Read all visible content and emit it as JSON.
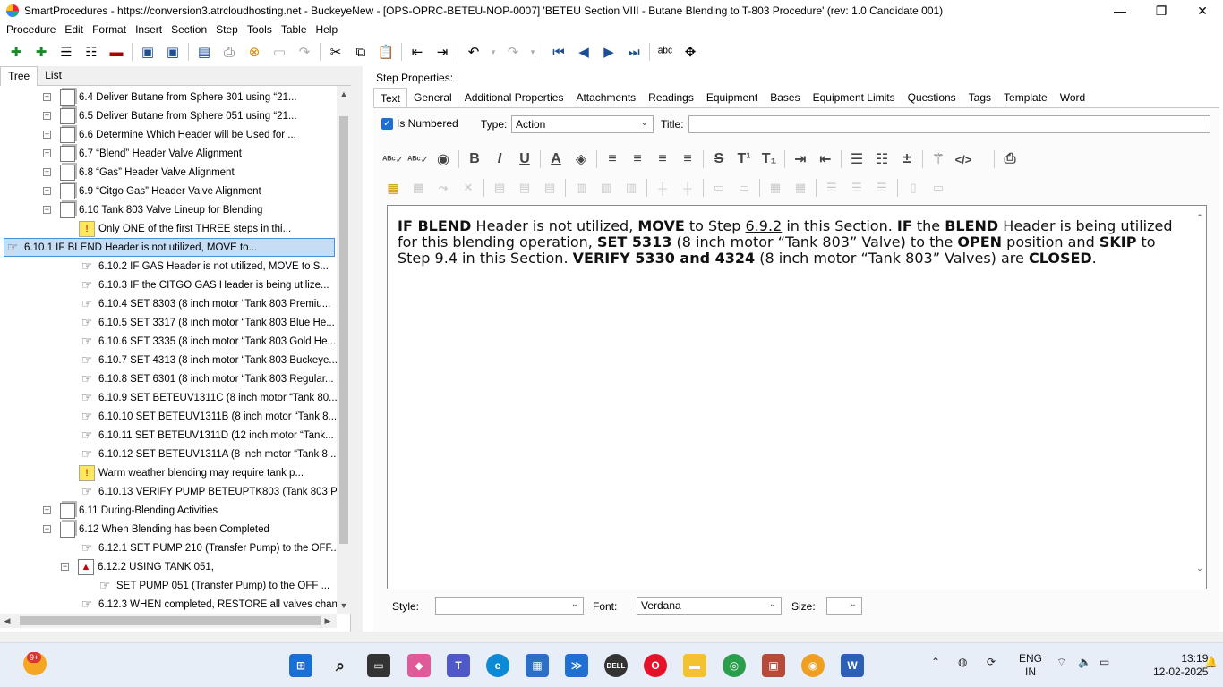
{
  "window": {
    "title": "SmartProcedures - https://conversion3.atrcloudhosting.net - BuckeyeNew - [OPS-OPRC-BETEU-NOP-0007] 'BETEU Section VIII - Butane Blending to T-803 Procedure' (rev: 1.0 Candidate 001)",
    "minimize": "—",
    "maximize": "❐",
    "close": "✕"
  },
  "menu": [
    "Procedure",
    "Edit",
    "Format",
    "Insert",
    "Section",
    "Step",
    "Tools",
    "Table",
    "Help"
  ],
  "left_tabs": [
    "Tree",
    "List"
  ],
  "tree": [
    {
      "label": "6.4 Deliver Butane from Sphere 301 using “21...",
      "indent": 0,
      "kind": "section",
      "expander": "+"
    },
    {
      "label": "6.5 Deliver Butane from Sphere 051 using “21...",
      "indent": 0,
      "kind": "section",
      "expander": "+"
    },
    {
      "label": "6.6 Determine Which Header will be Used for ...",
      "indent": 0,
      "kind": "section",
      "expander": "+"
    },
    {
      "label": "6.7 “Blend” Header Valve Alignment",
      "indent": 0,
      "kind": "section",
      "expander": "+"
    },
    {
      "label": "6.8 “Gas” Header Valve Alignment",
      "indent": 0,
      "kind": "section",
      "expander": "+"
    },
    {
      "label": "6.9 “Citgo Gas” Header Valve Alignment",
      "indent": 0,
      "kind": "section",
      "expander": "+"
    },
    {
      "label": "6.10 Tank 803 Valve Lineup for Blending",
      "indent": 0,
      "kind": "section",
      "expander": "−"
    },
    {
      "label": "Only ONE of the first THREE steps in thi...",
      "indent": 1,
      "kind": "note"
    },
    {
      "label": "6.10.1 IF BLEND Header is not utilized, MOVE to...",
      "indent": 1,
      "kind": "step",
      "selected": true
    },
    {
      "label": "6.10.2 IF GAS Header is not utilized, MOVE to S...",
      "indent": 1,
      "kind": "step"
    },
    {
      "label": "6.10.3 IF the CITGO GAS Header is being utilize...",
      "indent": 1,
      "kind": "step"
    },
    {
      "label": "6.10.4 SET 8303 (8 inch motor “Tank 803 Premiu...",
      "indent": 1,
      "kind": "step"
    },
    {
      "label": "6.10.5 SET 3317 (8 inch motor “Tank 803 Blue He...",
      "indent": 1,
      "kind": "step"
    },
    {
      "label": "6.10.6 SET 3335 (8 inch motor “Tank 803 Gold He...",
      "indent": 1,
      "kind": "step"
    },
    {
      "label": "6.10.7 SET 4313 (8 inch motor “Tank 803 Buckeye...",
      "indent": 1,
      "kind": "step"
    },
    {
      "label": "6.10.8 SET 6301 (8 inch motor “Tank 803 Regular...",
      "indent": 1,
      "kind": "step"
    },
    {
      "label": "6.10.9 SET BETEUV1311C (8 inch motor “Tank 80...",
      "indent": 1,
      "kind": "step"
    },
    {
      "label": "6.10.10 SET BETEUV1311B (8 inch motor “Tank 8...",
      "indent": 1,
      "kind": "step"
    },
    {
      "label": "6.10.11 SET BETEUV1311D (12 inch motor “Tank...",
      "indent": 1,
      "kind": "step"
    },
    {
      "label": "6.10.12 SET BETEUV1311A (8 inch motor “Tank 8...",
      "indent": 1,
      "kind": "step"
    },
    {
      "label": "Warm weather blending may require tank p...",
      "indent": 1,
      "kind": "note"
    },
    {
      "label": "6.10.13 VERIFY PUMP BETEUPTK803 (Tank 803 P...",
      "indent": 1,
      "kind": "step"
    },
    {
      "label": "6.11 During-Blending Activities",
      "indent": 0,
      "kind": "section",
      "expander": "+"
    },
    {
      "label": "6.12 When Blending has been Completed",
      "indent": 0,
      "kind": "section",
      "expander": "−"
    },
    {
      "label": "6.12.1 SET PUMP 210 (Transfer Pump) to the OFF...",
      "indent": 1,
      "kind": "step"
    },
    {
      "label": "6.12.2 USING TANK 051,",
      "indent": 1,
      "kind": "cond",
      "expander": "−"
    },
    {
      "label": "SET PUMP 051 (Transfer Pump) to the OFF ...",
      "indent": 2,
      "kind": "step"
    },
    {
      "label": "6.12.3 WHEN completed, RESTORE all valves chan...",
      "indent": 1,
      "kind": "step"
    }
  ],
  "step_properties_label": "Step Properties:",
  "prop_tabs": [
    "Text",
    "General",
    "Additional Properties",
    "Attachments",
    "Readings",
    "Equipment",
    "Bases",
    "Equipment Limits",
    "Questions",
    "Tags",
    "Template",
    "Word"
  ],
  "text_tab": {
    "is_numbered_label": "Is Numbered",
    "is_numbered": true,
    "type_label": "Type:",
    "type_value": "Action",
    "title_label": "Title:",
    "title_value": ""
  },
  "step_text": [
    {
      "t": "IF BLEND",
      "b": true
    },
    {
      "t": " Header is not utilized, "
    },
    {
      "t": "MOVE",
      "b": true
    },
    {
      "t": " to Step "
    },
    {
      "t": "6.9.2",
      "u": true
    },
    {
      "t": " in this Section. "
    },
    {
      "t": "IF",
      "b": true
    },
    {
      "t": " the "
    },
    {
      "t": "BLEND",
      "b": true
    },
    {
      "t": " Header is being utilized for this blending operation, "
    },
    {
      "t": "SET 5313",
      "b": true
    },
    {
      "t": " (8 inch motor “Tank 803” Valve) to the "
    },
    {
      "t": "OPEN",
      "b": true
    },
    {
      "t": " position and "
    },
    {
      "t": "SKIP",
      "b": true
    },
    {
      "t": " to Step 9.4 in this Section. "
    },
    {
      "t": "VERIFY 5330 and 4324",
      "b": true
    },
    {
      "t": " (8 inch motor “Tank 803” Valves) are "
    },
    {
      "t": "CLOSED",
      "b": true
    },
    {
      "t": "."
    }
  ],
  "bottom": {
    "style_label": "Style:",
    "style_value": "",
    "font_label": "Font:",
    "font_value": "Verdana",
    "size_label": "Size:",
    "size_value": ""
  },
  "taskbar": {
    "badge": "9+",
    "lang_1": "ENG",
    "lang_2": "IN",
    "time": "13:19",
    "date": "12-02-2025"
  },
  "colors": {
    "selection": "#c5def6",
    "selection_border": "#4a90d9",
    "accent": "#1e6fd0"
  }
}
